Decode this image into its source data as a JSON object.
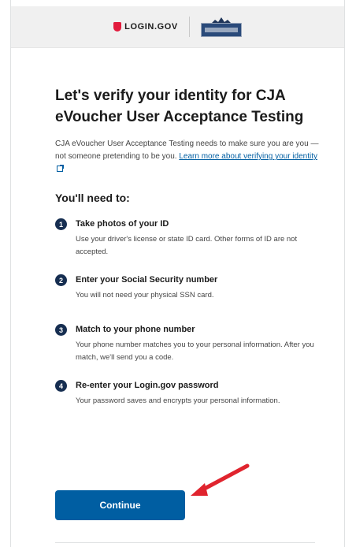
{
  "header": {
    "login_logo_text": "LOGIN.GOV",
    "agency_logo_icon": "agency-seal-icon"
  },
  "main": {
    "title": "Let's verify your identity for CJA eVoucher User Acceptance Testing",
    "intro_text": "CJA eVoucher User Acceptance Testing needs to make sure you are you — not someone pretending to be you.",
    "learn_more_link": "Learn more about verifying your identity",
    "need_heading": "You'll need to:",
    "steps": [
      {
        "number": "1",
        "title": "Take photos of your ID",
        "description": "Use your driver's license or state ID card. Other forms of ID are not accepted."
      },
      {
        "number": "2",
        "title": "Enter your Social Security number",
        "description": "You will not need your physical SSN card."
      },
      {
        "number": "3",
        "title": "Match to your phone number",
        "description": "Your phone number matches you to your personal information. After you match, we'll send you a code."
      },
      {
        "number": "4",
        "title": "Re-enter your Login.gov password",
        "description": "Your password saves and encrypts your personal information."
      }
    ],
    "continue_label": "Continue"
  },
  "colors": {
    "primary": "#005ea2",
    "step_badge": "#162e51",
    "annotation_arrow": "#e0242e",
    "login_shield": "#e21c3d"
  }
}
